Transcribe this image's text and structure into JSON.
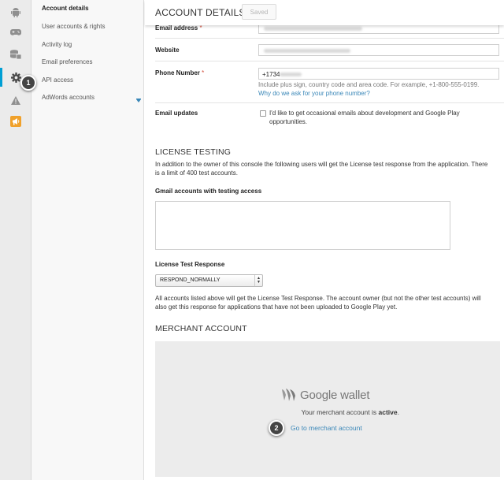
{
  "rail": {
    "icons": [
      "android-icon",
      "gamepad-icon",
      "database-icon",
      "gear-icon",
      "warning-icon",
      "megaphone-icon"
    ]
  },
  "sidebar": {
    "items": [
      {
        "label": "Account details",
        "active": true
      },
      {
        "label": "User accounts & rights",
        "active": false
      },
      {
        "label": "Activity log",
        "active": false
      },
      {
        "label": "Email preferences",
        "active": false
      },
      {
        "label": "API access",
        "active": false
      },
      {
        "label": "AdWords accounts",
        "active": false
      }
    ]
  },
  "badges": {
    "one": "1",
    "two": "2"
  },
  "header": {
    "title": "ACCOUNT DETAILS",
    "saved_label": "Saved"
  },
  "fields": {
    "email": {
      "label": "Email address",
      "required": "*"
    },
    "website": {
      "label": "Website"
    },
    "phone": {
      "label": "Phone Number",
      "required": "*",
      "value": "+1734",
      "hint": "Include plus sign, country code and area code. For example, +1-800-555-0199.",
      "hint_link": "Why do we ask for your phone number?"
    },
    "email_updates": {
      "label": "Email updates",
      "checkbox_text": "I'd like to get occasional emails about development and Google Play opportunities."
    }
  },
  "license_testing": {
    "title": "LICENSE TESTING",
    "description": "In addition to the owner of this console the following users will get the License test response from the application. There is a limit of 400 test accounts.",
    "gmail_label": "Gmail accounts with testing access",
    "response_label": "License Test Response",
    "response_value": "RESPOND_NORMALLY",
    "response_note": "All accounts listed above will get the License Test Response. The account owner (but not the other test accounts) will also get this response for applications that have not been uploaded to Google Play yet."
  },
  "merchant": {
    "title": "MERCHANT ACCOUNT",
    "logo_text": "Google wallet",
    "status_prefix": "Your merchant account is ",
    "status_value": "active",
    "status_suffix": ".",
    "link": "Go to merchant account"
  },
  "colors": {
    "accent": "#009fd4",
    "link": "#3a87b8",
    "required": "#d14836",
    "megaphone": "#f0a12b"
  }
}
